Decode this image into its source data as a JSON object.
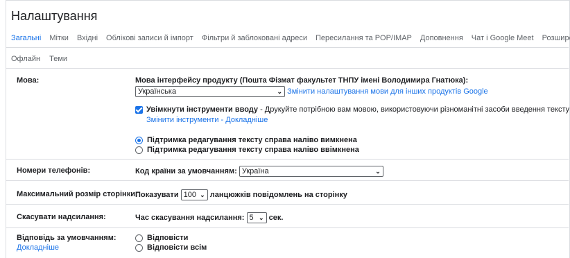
{
  "page_title": "Налаштування",
  "tabs": [
    {
      "label": "Загальні",
      "active": true
    },
    {
      "label": "Мітки",
      "active": false
    },
    {
      "label": "Вхідні",
      "active": false
    },
    {
      "label": "Облікові записи й імпорт",
      "active": false
    },
    {
      "label": "Фільтри й заблоковані адреси",
      "active": false
    },
    {
      "label": "Пересилання та POP/IMAP",
      "active": false
    },
    {
      "label": "Доповнення",
      "active": false
    },
    {
      "label": "Чат і Google Meet",
      "active": false
    },
    {
      "label": "Розширені",
      "active": false
    }
  ],
  "subtabs": [
    {
      "label": "Офлайн"
    },
    {
      "label": "Теми"
    }
  ],
  "language": {
    "label": "Мова:",
    "heading": "Мова інтерфейсу продукту (Пошта Фізмат факультет ТНПУ імені Володимира Гнатюка):",
    "selected": "Українська",
    "change_link": "Змінити налаштування мови для інших продуктів Google",
    "input_tools_checked": true,
    "input_tools_label": "Увімкнути інструменти вводу",
    "input_tools_desc": " - Друкуйте потрібною вам мовою, використовуючи різноманітні засоби введення тексту -",
    "change_tools_link": "Змінити інструменти",
    "sep": " - ",
    "more_link": "Докладніше",
    "rtl_off": "Підтримка редагування тексту справа наліво вимкнена",
    "rtl_on": "Підтримка редагування тексту справа наліво ввімкнена",
    "rtl_selected": "off"
  },
  "phone": {
    "label": "Номери телефонів:",
    "country_label": "Код країни за умовчанням:",
    "country_value": "Україна"
  },
  "page_size": {
    "label": "Максимальний розмір сторінки:",
    "prefix": "Показувати",
    "value": "100",
    "suffix": "ланцюжків повідомлень на сторінку"
  },
  "undo_send": {
    "label": "Скасувати надсилання:",
    "prefix": "Час скасування надсилання:",
    "value": "5",
    "suffix": "сек."
  },
  "default_reply": {
    "label": "Відповідь за умовчанням:",
    "more_link": "Докладніше",
    "option_reply": "Відповісти",
    "option_reply_all": "Відповісти всім"
  },
  "colors": {
    "accent": "#1a73e8",
    "divider": "#dadce0"
  }
}
